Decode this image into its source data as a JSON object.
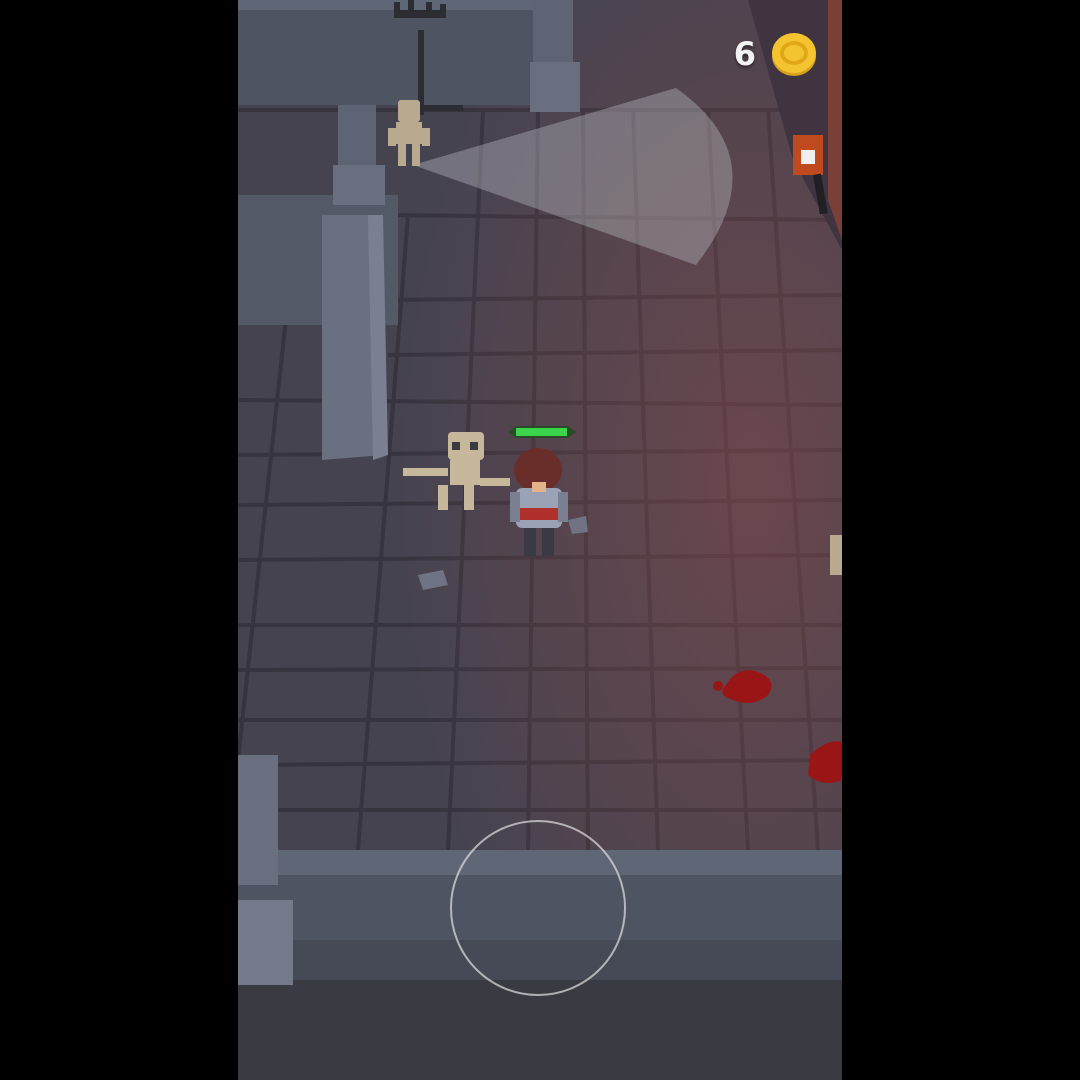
{
  "hud": {
    "coins": "6",
    "coin_icon": "gold-coin-icon"
  },
  "player": {
    "health_fraction": 0.85,
    "health_color": "#3bd44a"
  },
  "joystick": {
    "icon": "virtual-joystick-ring"
  },
  "colors": {
    "floor": "#454350",
    "wall": "#5a5f6e",
    "vision_cone": "#c9ccd4",
    "blood": "#9a1616",
    "torch_glow": "#8a4a4a"
  }
}
